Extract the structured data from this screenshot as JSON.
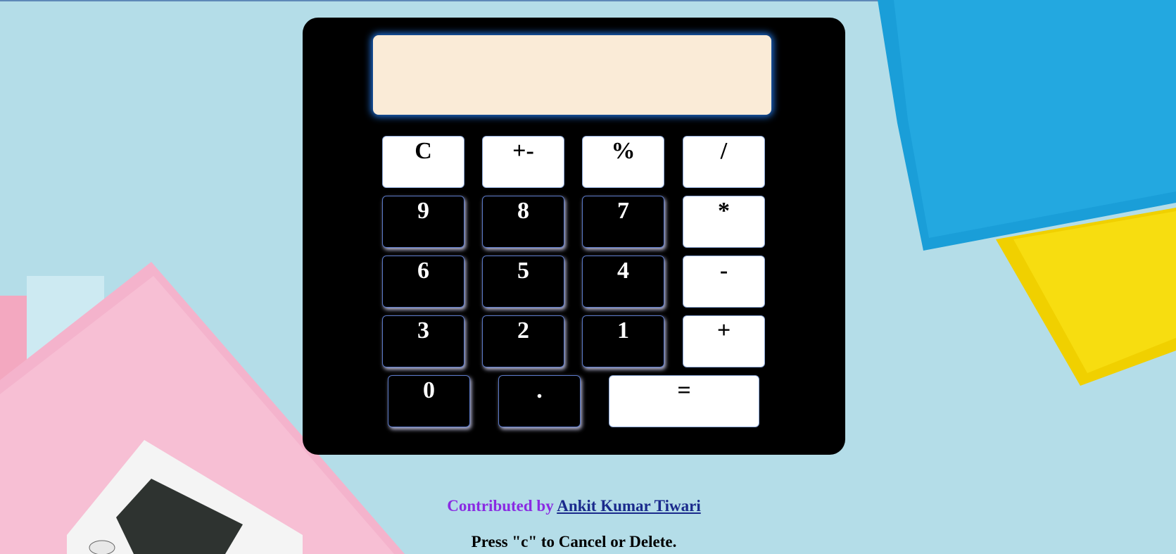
{
  "display": {
    "value": "",
    "placeholder": ""
  },
  "keys": {
    "clear": "C",
    "negate": "+-",
    "percent": "%",
    "divide": "/",
    "nine": "9",
    "eight": "8",
    "seven": "7",
    "multiply": "*",
    "six": "6",
    "five": "5",
    "four": "4",
    "subtract": "-",
    "three": "3",
    "two": "2",
    "one": "1",
    "add": "+",
    "zero": "0",
    "decimal": ".",
    "equals": "="
  },
  "footer": {
    "contributed_prefix": "Contributed by",
    "author_name": "Ankit Kumar Tiwari",
    "hint": "Press \"c\" to Cancel or Delete."
  },
  "colors": {
    "page_background": "#b4dde8",
    "calculator_body": "#000000",
    "display_background": "#faebd7",
    "display_glow": "#1f6fd6",
    "credit_text": "#8a2be2",
    "author_link": "#1a2a8c"
  }
}
